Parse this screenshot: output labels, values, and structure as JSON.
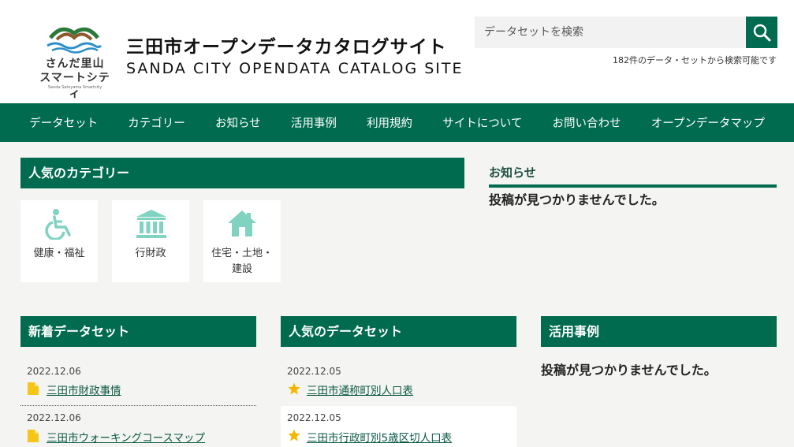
{
  "header": {
    "logo_line1": "さんだ里山",
    "logo_line2": "スマートシティ",
    "logo_tiny": "Sanda Satoyama Smartcity",
    "title_ja": "三田市オープンデータカタログサイト",
    "title_en": "SANDA CITY OPENDATA CATALOG SITE",
    "search_placeholder": "データセットを検索",
    "search_note": "182件のデータ・セットから検索可能です"
  },
  "nav": {
    "items": [
      "データセット",
      "カテゴリー",
      "お知らせ",
      "活用事例",
      "利用規約",
      "サイトについて",
      "お問い合わせ",
      "オープンデータマップ"
    ]
  },
  "popular_categories": {
    "heading": "人気のカテゴリー",
    "items": [
      {
        "label": "健康・福祉",
        "icon": "wheelchair-icon"
      },
      {
        "label": "行財政",
        "icon": "government-building-icon"
      },
      {
        "label": "住宅・土地・建設",
        "label_line1": "住宅・土地・",
        "label_line2": "建設",
        "icon": "house-icon"
      }
    ]
  },
  "news": {
    "heading": "お知らせ",
    "empty": "投稿が見つかりませんでした。"
  },
  "new_datasets": {
    "heading": "新着データセット",
    "items": [
      {
        "date": "2022.12.06",
        "title": "三田市財政事情",
        "icon": "file-icon"
      },
      {
        "date": "2022.12.06",
        "title": "三田市ウォーキングコースマップ",
        "icon": "file-icon"
      }
    ]
  },
  "popular_datasets": {
    "heading": "人気のデータセット",
    "items": [
      {
        "date": "2022.12.05",
        "title": "三田市通称町別人口表",
        "icon": "star-icon"
      },
      {
        "date": "2022.12.05",
        "title": "三田市行政町別5歳区切人口表",
        "icon": "star-icon"
      }
    ]
  },
  "use_cases": {
    "heading": "活用事例",
    "empty": "投稿が見つかりませんでした。"
  },
  "colors": {
    "brand_green": "#006b4f",
    "category_icon": "#7fd3c0",
    "file_icon": "#f5c518",
    "star_icon": "#f5b800"
  }
}
